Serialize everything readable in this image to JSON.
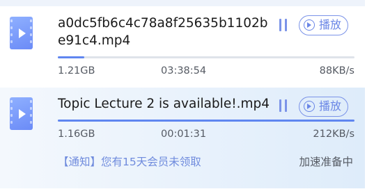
{
  "downloads": [
    {
      "filename": "a0dc5fb6c4c78a8f25635b1102be91c4.mp4",
      "size": "1.21GB",
      "time_remaining": "03:38:54",
      "speed": "88KB/s",
      "progress": 0.09,
      "play_label": "播放"
    },
    {
      "filename": "Topic Lecture 2 is available!.mp4",
      "size": "1.16GB",
      "time_remaining": "00:01:31",
      "speed": "212KB/s",
      "progress": 1.0,
      "play_label": "播放",
      "notice": "【通知】您有15天会员未领取",
      "accel_status": "加速准备中"
    }
  ],
  "colors": {
    "accent": "#6a86e6",
    "progress": "#5f86f0",
    "selected_bg": "#e9f2fc"
  }
}
